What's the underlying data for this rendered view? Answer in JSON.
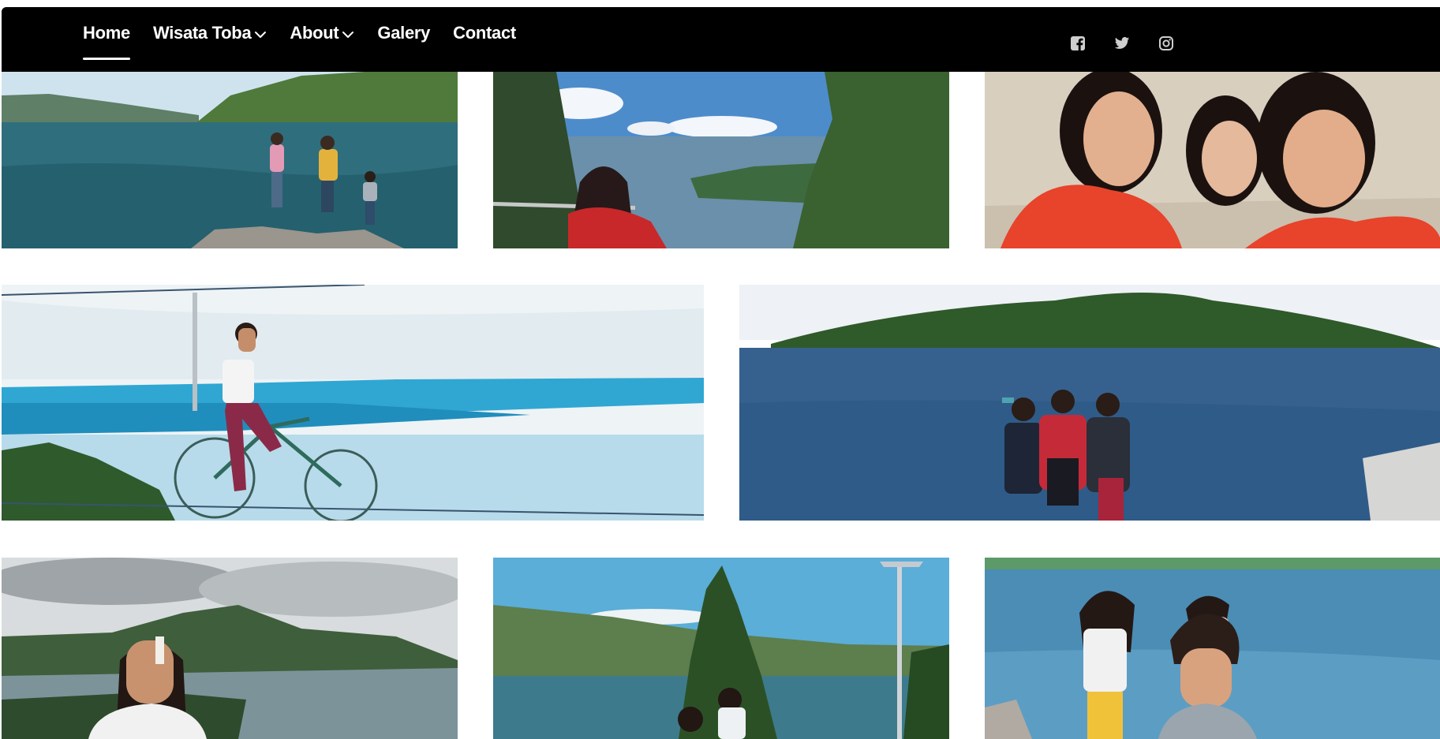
{
  "nav": {
    "items": [
      {
        "label": "Home",
        "active": true
      },
      {
        "label": "Wisata Toba",
        "dropdown": true
      },
      {
        "label": "About",
        "dropdown": true
      },
      {
        "label": "Galery"
      },
      {
        "label": "Contact"
      }
    ],
    "social_icons": [
      "facebook-icon",
      "twitter-icon",
      "instagram-icon"
    ]
  },
  "gallery": {
    "photos": [
      {
        "subject": "lake-shore-children"
      },
      {
        "subject": "girl-overlooking-lake"
      },
      {
        "subject": "girls-selfie-in-water"
      },
      {
        "subject": "girl-on-sky-bicycle"
      },
      {
        "subject": "three-girls-by-lake"
      },
      {
        "subject": "girl-with-mountain-view"
      },
      {
        "subject": "couple-under-pine"
      },
      {
        "subject": "children-on-beach"
      }
    ]
  },
  "colors": {
    "navbar": "#000000",
    "nav_text": "#ffffff",
    "social_icon": "#cfcfcf",
    "page_background": "#ffffff"
  }
}
